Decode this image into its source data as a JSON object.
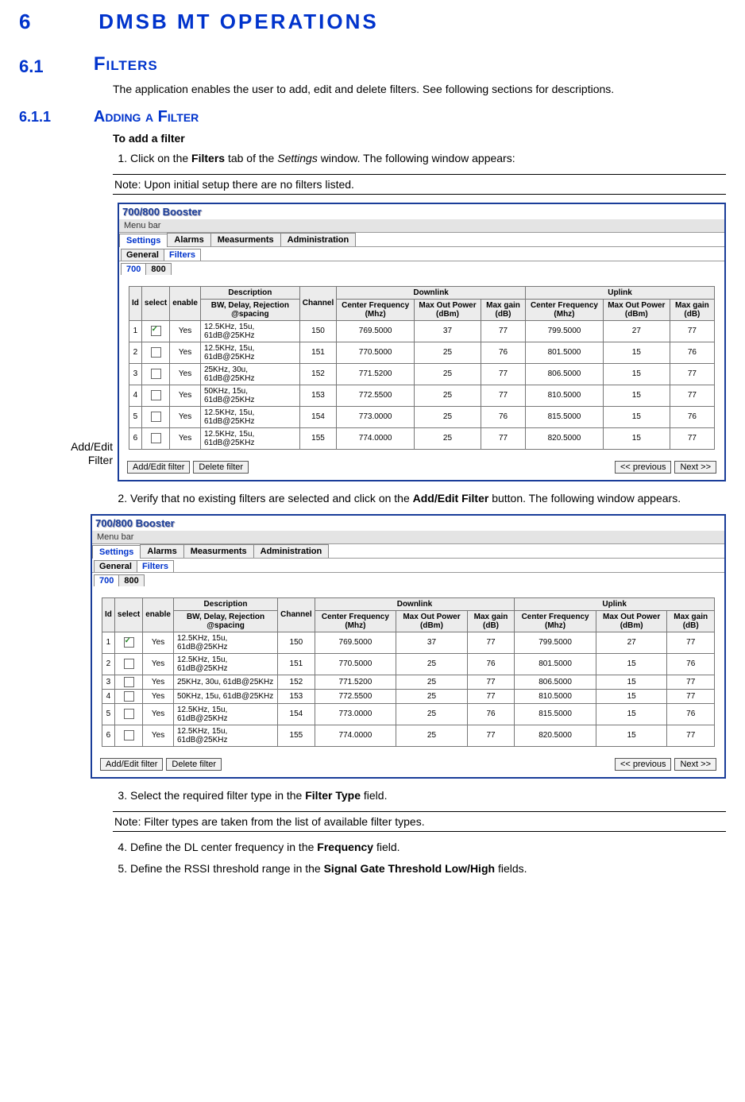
{
  "chapter": {
    "num": "6",
    "title": "DMSB MT OPERATIONS"
  },
  "section": {
    "num": "6.1",
    "title": "Filters"
  },
  "section_intro": "The application enables the user to add, edit and delete filters. See following sections for descriptions.",
  "subsection": {
    "num": "6.1.1",
    "title": "Adding a Filter",
    "lede": "To add a filter"
  },
  "steps": {
    "s1_a": "Click on the ",
    "s1_b": "Filters",
    "s1_c": " tab of the ",
    "s1_d": "Settings",
    "s1_e": " window. The following window appears:",
    "note1": "Note: Upon initial setup there are no filters listed.",
    "s2_a": "Verify that no existing filters are selected and click on the ",
    "s2_b": "Add/Edit Filter",
    "s2_c": " button. The following window appears.",
    "s3_a": "Select the required filter type in the ",
    "s3_b": "Filter Type",
    "s3_c": " field.",
    "note2": "Note: Filter types are taken from the list of available filter types.",
    "s4_a": "Define the DL center frequency in the ",
    "s4_b": "Frequency",
    "s4_c": " field.",
    "s5_a": "Define the RSSI threshold range in the ",
    "s5_b": "Signal Gate Threshold Low/High",
    "s5_c": " fields."
  },
  "annotation": {
    "line1": "Add/Edit",
    "line2": "Filter"
  },
  "shot": {
    "title": "700/800 Booster",
    "menubar": "Menu bar",
    "main_tabs": {
      "settings": "Settings",
      "alarms": "Alarms",
      "meas": "Measurments",
      "admin": "Administration"
    },
    "sub_tabs": {
      "general": "General",
      "filters": "Filters"
    },
    "band_tabs": {
      "b700": "700",
      "b800": "800"
    },
    "headers": {
      "id": "Id",
      "select": "select",
      "enable": "enable",
      "desc": "Description",
      "desc_sub": "BW,  Delay, Rejection @spacing",
      "channel": "Channel",
      "downlink": "Downlink",
      "uplink": "Uplink",
      "cf": "Center Frequency (Mhz)",
      "mop": "Max Out Power (dBm)",
      "mg": "Max gain (dB)"
    },
    "rows": [
      {
        "id": "1",
        "sel": true,
        "en": "Yes",
        "desc": "12.5KHz, 15u, 61dB@25KHz",
        "ch": "150",
        "dcf": "769.5000",
        "dmop": "37",
        "dmg": "77",
        "ucf": "799.5000",
        "umop": "27",
        "umg": "77"
      },
      {
        "id": "2",
        "sel": false,
        "en": "Yes",
        "desc": "12.5KHz, 15u, 61dB@25KHz",
        "ch": "151",
        "dcf": "770.5000",
        "dmop": "25",
        "dmg": "76",
        "ucf": "801.5000",
        "umop": "15",
        "umg": "76"
      },
      {
        "id": "3",
        "sel": false,
        "en": "Yes",
        "desc": "25KHz,    30u, 61dB@25KHz",
        "ch": "152",
        "dcf": "771.5200",
        "dmop": "25",
        "dmg": "77",
        "ucf": "806.5000",
        "umop": "15",
        "umg": "77"
      },
      {
        "id": "4",
        "sel": false,
        "en": "Yes",
        "desc": "50KHz,    15u, 61dB@25KHz",
        "ch": "153",
        "dcf": "772.5500",
        "dmop": "25",
        "dmg": "77",
        "ucf": "810.5000",
        "umop": "15",
        "umg": "77"
      },
      {
        "id": "5",
        "sel": false,
        "en": "Yes",
        "desc": "12.5KHz, 15u, 61dB@25KHz",
        "ch": "154",
        "dcf": "773.0000",
        "dmop": "25",
        "dmg": "76",
        "ucf": "815.5000",
        "umop": "15",
        "umg": "76"
      },
      {
        "id": "6",
        "sel": false,
        "en": "Yes",
        "desc": "12.5KHz, 15u, 61dB@25KHz",
        "ch": "155",
        "dcf": "774.0000",
        "dmop": "25",
        "dmg": "77",
        "ucf": "820.5000",
        "umop": "15",
        "umg": "77"
      }
    ],
    "buttons": {
      "addedit": "Add/Edit filter",
      "delete": "Delete filter",
      "prev": "<< previous",
      "next": "Next  >>"
    }
  }
}
